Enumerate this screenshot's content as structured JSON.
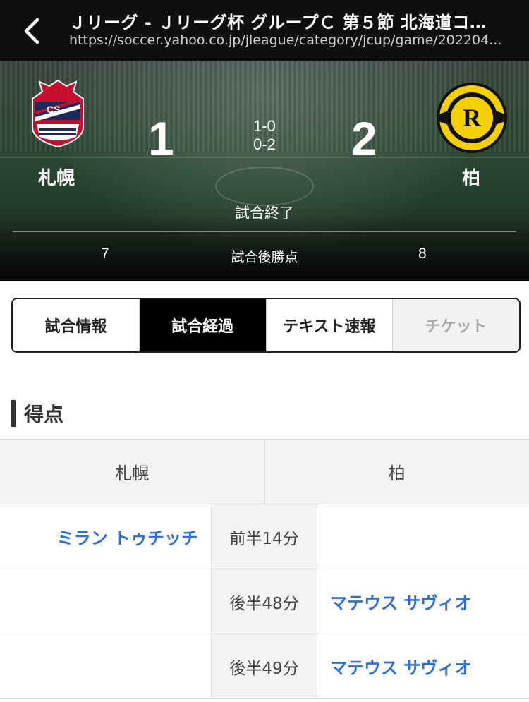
{
  "browser": {
    "title": "Ｊリーグ - Ｊリーグ杯 グループＣ 第５節 北海道コ…",
    "url": "https://soccer.yahoo.co.jp/jleague/category/jcup/game/202204..."
  },
  "match": {
    "home": {
      "name": "札幌",
      "score": "1",
      "points": "7"
    },
    "away": {
      "name": "柏",
      "score": "2",
      "points": "8"
    },
    "first_half": "1-0",
    "second_half": "0-2",
    "status": "試合終了",
    "points_label": "試合後勝点"
  },
  "tabs": [
    {
      "label": "試合情報"
    },
    {
      "label": "試合経過"
    },
    {
      "label": "テキスト速報"
    },
    {
      "label": "チケット"
    }
  ],
  "goals": {
    "title": "得点",
    "home_header": "札幌",
    "away_header": "柏",
    "rows": [
      {
        "home": "ミラン トゥチッチ",
        "time": "前半14分",
        "away": ""
      },
      {
        "home": "",
        "time": "後半48分",
        "away": "マテウス サヴィオ"
      },
      {
        "home": "",
        "time": "後半49分",
        "away": "マテウス サヴィオ"
      }
    ]
  },
  "colors": {
    "player_link": "#2f6fd6",
    "active_tab": "#000000",
    "topbar": "#0f0f0f"
  },
  "icons": {
    "back": "chevron-left-icon",
    "home_logo": "consadole-sapporo-logo",
    "away_logo": "kashiwa-reysol-logo"
  }
}
